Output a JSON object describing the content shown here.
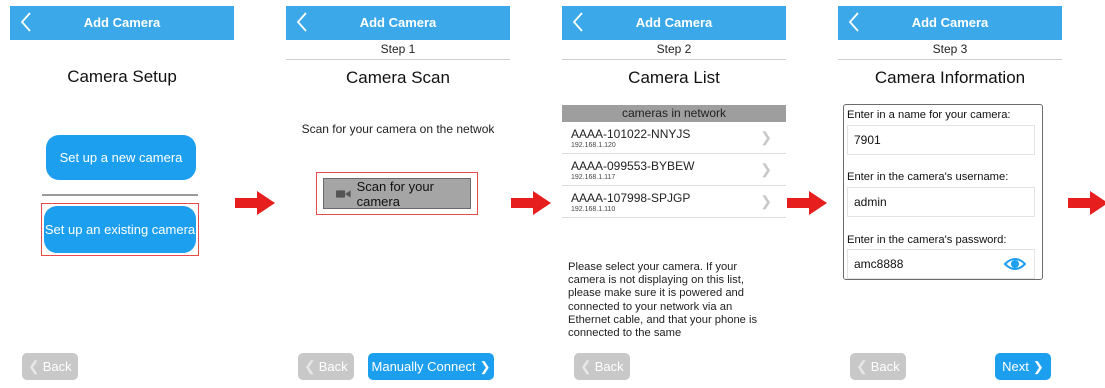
{
  "screens": [
    {
      "nav_title": "Add Camera",
      "title": "Camera Setup",
      "buttons": [
        "Set up a new camera",
        "Set up an existing camera"
      ],
      "back_label": "Back"
    },
    {
      "nav_title": "Add Camera",
      "step": "Step 1",
      "title": "Camera Scan",
      "instruction": "Scan for your camera on the netwok",
      "scan_label": "Scan for your camera",
      "back_label": "Back",
      "primary_label": "Manually Connect"
    },
    {
      "nav_title": "Add Camera",
      "step": "Step 2",
      "title": "Camera List",
      "list_header": "cameras in network",
      "cameras": [
        {
          "name": "AAAA-101022-NNYJS",
          "ip": "192.168.1.120"
        },
        {
          "name": "AAAA-099553-BYBEW",
          "ip": "192.168.1.117"
        },
        {
          "name": "AAAA-107998-SPJGP",
          "ip": "192.168.1.110"
        }
      ],
      "help": "Please select your camera. If your camera is not displaying on this list, please make sure it is powered and connected to your network via an Ethernet cable, and that your phone is connected to the same",
      "back_label": "Back"
    },
    {
      "nav_title": "Add Camera",
      "step": "Step 3",
      "title": "Camera Information",
      "name_label": "Enter in a name for your camera:",
      "name_value": "7901",
      "username_label": "Enter in the camera's username:",
      "username_value": "admin",
      "password_label": "Enter in the camera's password:",
      "password_value": "amc8888",
      "back_label": "Back",
      "primary_label": "Next"
    }
  ],
  "colors": {
    "nav_blue": "#3ba8ea",
    "button_blue": "#1d9ff0",
    "arrow_red": "#e61e1e",
    "highlight_red": "#e84b4b"
  },
  "icons": [
    "back-chevron-icon",
    "camera-icon",
    "chevron-right-icon",
    "eye-icon",
    "red-arrow-icon"
  ]
}
